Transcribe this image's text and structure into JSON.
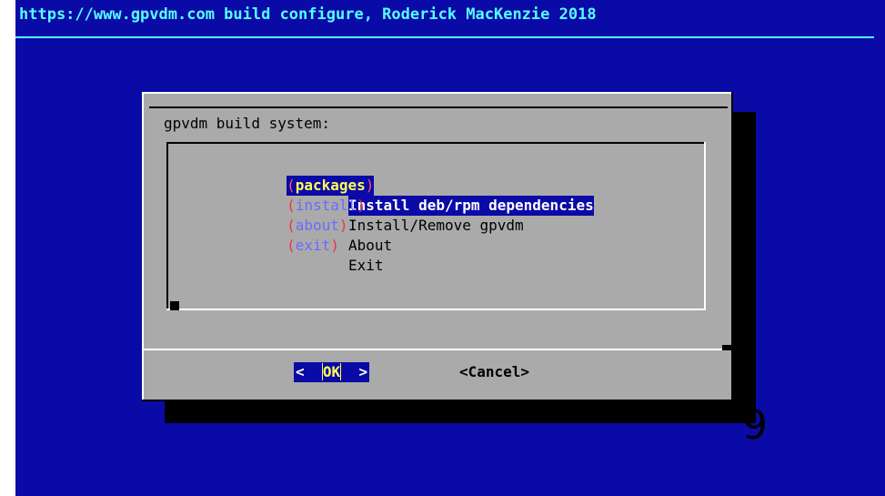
{
  "backtitle": "https://www.gpvdm.com build configure, Roderick MacKenzie 2018",
  "dialog": {
    "prompt": "gpvdm build system:",
    "menu": [
      {
        "tag": "packages",
        "item": "Install deb/rpm dependencies",
        "selected": true
      },
      {
        "tag": "install",
        "item": "Install/Remove gpvdm",
        "selected": false
      },
      {
        "tag": "about",
        "item": "About",
        "selected": false
      },
      {
        "tag": "exit",
        "item": "Exit",
        "selected": false
      }
    ],
    "buttons": {
      "ok_left": "<  ",
      "ok_label": "OK",
      "ok_right": "  >",
      "cancel": "<Cancel>"
    }
  },
  "overlay_text": "9",
  "colors": {
    "screen_bg": "#0a0aa6",
    "dialog_bg": "#aaaaaa",
    "title_fg": "#55ffff",
    "highlight_fg": "#ffff55"
  }
}
